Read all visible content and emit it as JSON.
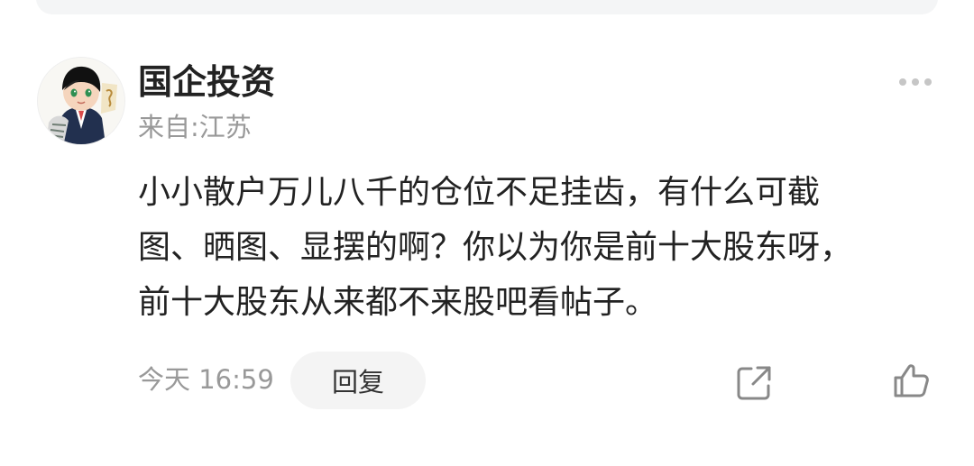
{
  "comment_card": {
    "author": {
      "name": "国企投资",
      "location": "来自:江苏",
      "avatar_icon": "cartoon-avatar-icon"
    },
    "body_lines": [
      "小小散户万儿八千的仓位不足挂齿，有什么可截",
      "图、晒图、显摆的啊？你以为你是前十大股东呀，",
      "前十大股东从来都不来股吧看帖子。"
    ],
    "footer": {
      "time": "今天 16:59",
      "reply_label": "回复",
      "share_icon": "share-icon",
      "like_icon": "thumbs-up-icon"
    },
    "more_icon": "more-dots-icon"
  },
  "colors": {
    "primary_text": "#222222",
    "secondary_text": "#999999",
    "button_bg": "#f4f4f4",
    "icon_gray": "#888888"
  }
}
